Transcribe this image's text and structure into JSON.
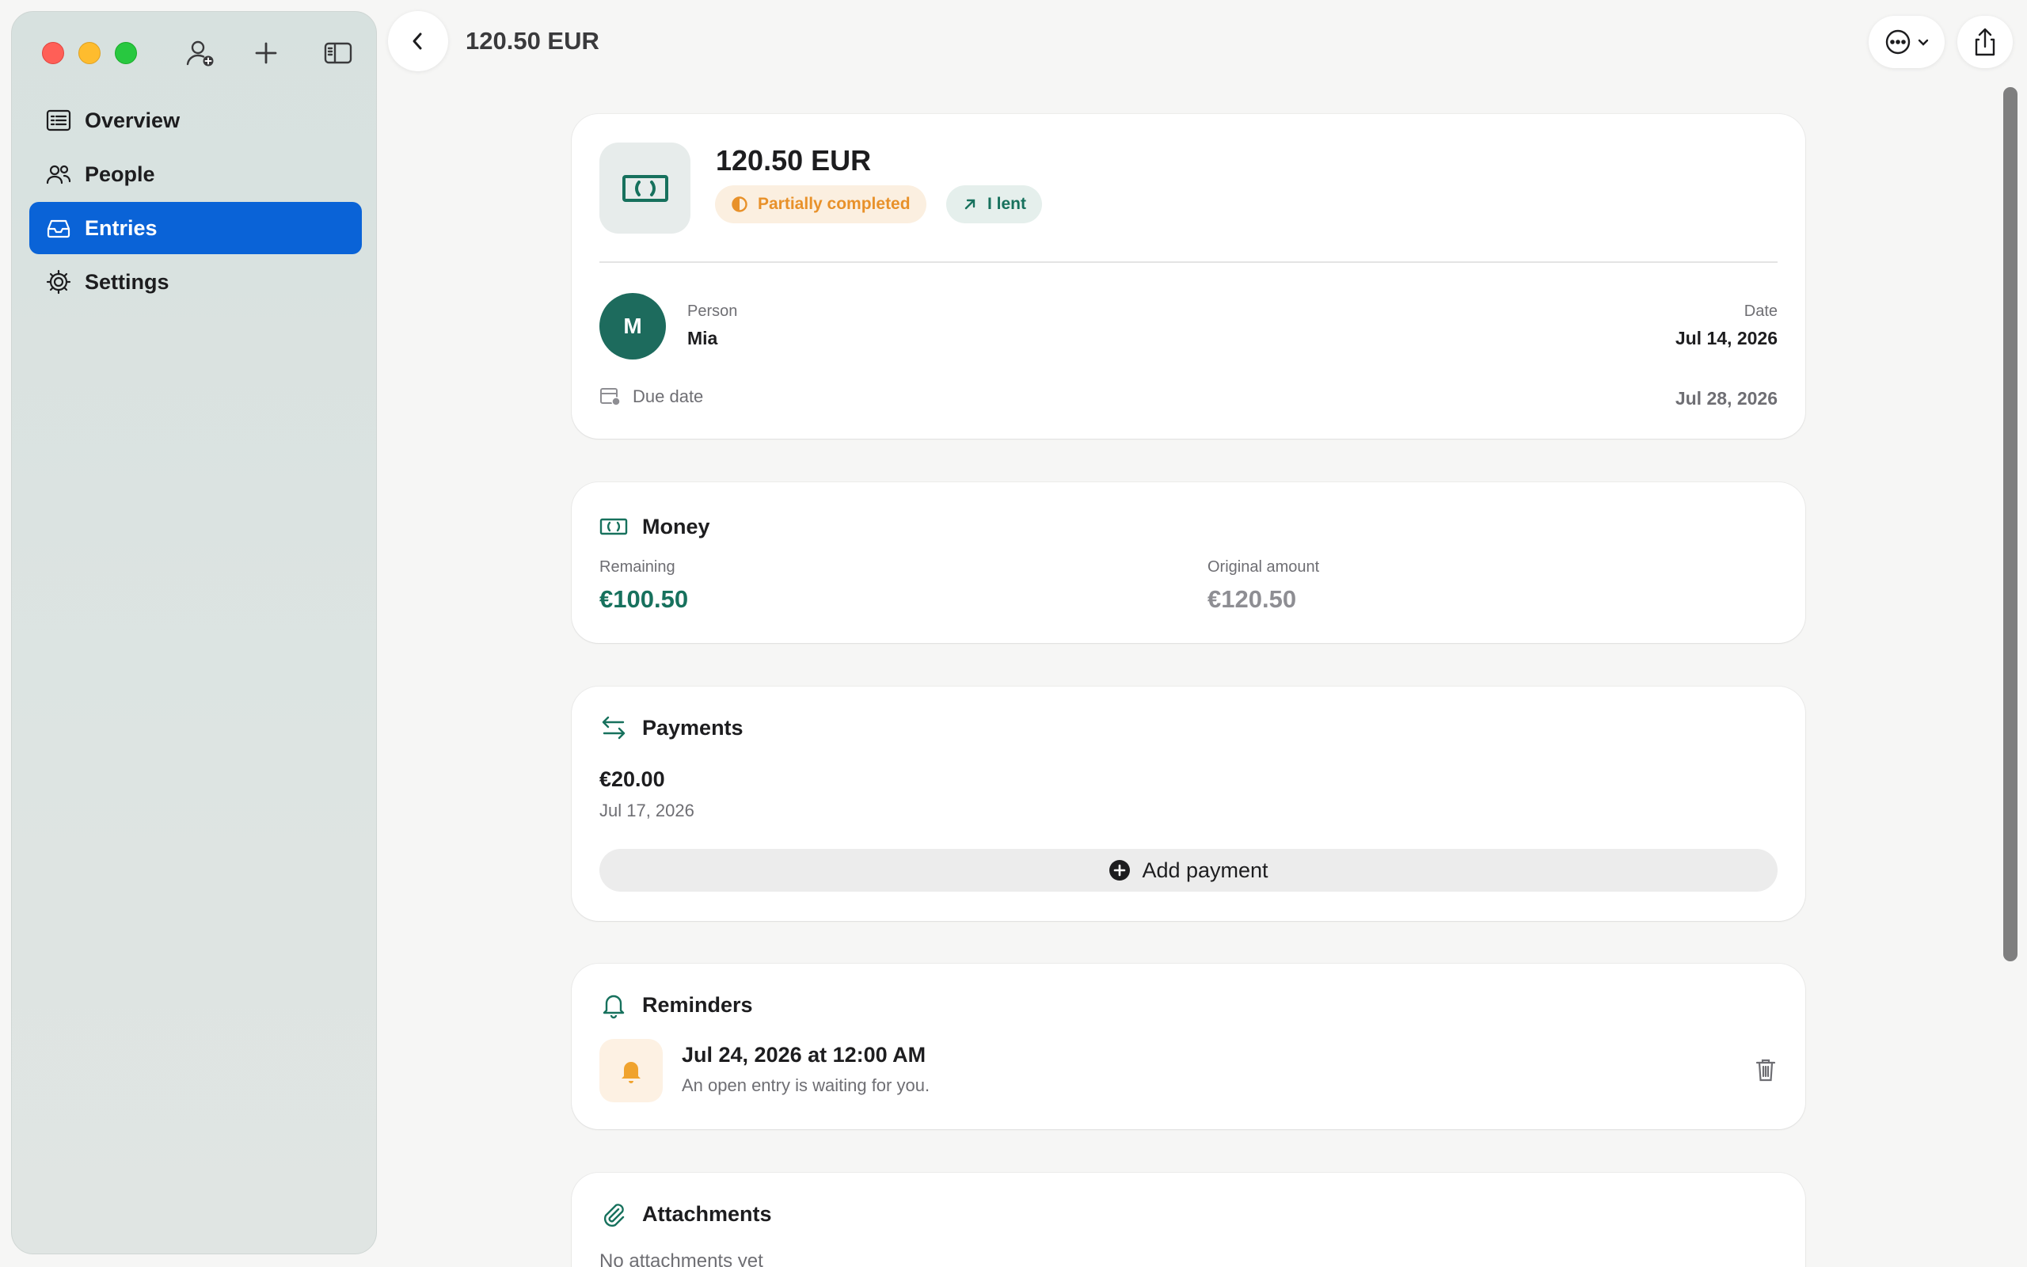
{
  "window": {
    "title": "120.50 EUR"
  },
  "sidebar": {
    "items": [
      {
        "label": "Overview",
        "icon": "list-icon"
      },
      {
        "label": "People",
        "icon": "people-icon"
      },
      {
        "label": "Entries",
        "icon": "tray-icon",
        "active": true
      },
      {
        "label": "Settings",
        "icon": "gear-icon"
      }
    ]
  },
  "entry": {
    "title": "120.50 EUR",
    "status": "Partially completed",
    "direction": "I lent",
    "person_label": "Person",
    "person_name": "Mia",
    "person_initial": "M",
    "date_label": "Date",
    "date_value": "Jul 14, 2026",
    "due_label": "Due date",
    "due_value": "Jul 28, 2026"
  },
  "money": {
    "title": "Money",
    "remaining_label": "Remaining",
    "remaining_value": "€100.50",
    "original_label": "Original amount",
    "original_value": "€120.50"
  },
  "payments": {
    "title": "Payments",
    "items": [
      {
        "amount": "€20.00",
        "date": "Jul 17, 2026"
      }
    ],
    "add_label": "Add payment"
  },
  "reminders": {
    "title": "Reminders",
    "items": [
      {
        "when": "Jul 24, 2026 at 12:00 AM",
        "message": "An open entry is waiting for you."
      }
    ]
  },
  "attachments": {
    "title": "Attachments",
    "empty_text": "No attachments yet"
  },
  "colors": {
    "accent": "#0a63d7",
    "brand_green": "#17715d",
    "status_orange": "#e8912a"
  }
}
